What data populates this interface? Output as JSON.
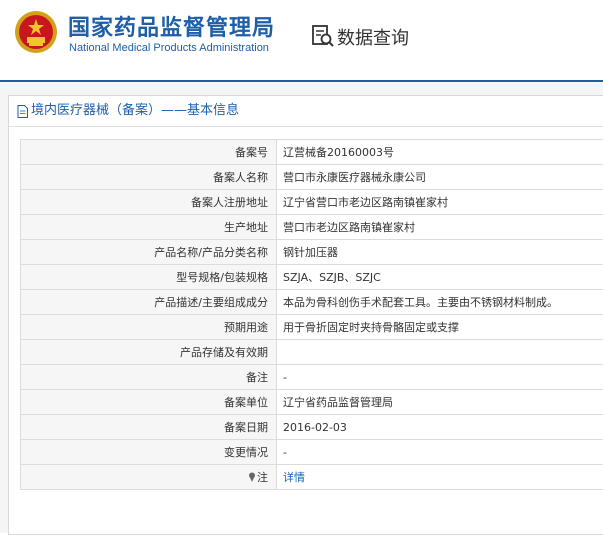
{
  "header": {
    "title": "国家药品监督管理局",
    "subtitle": "National Medical Products Administration",
    "query_label": "数据查询",
    "brand_color": "#1e5fa8"
  },
  "panel": {
    "title": "境内医疗器械（备案）——基本信息"
  },
  "record": {
    "rows": [
      {
        "label": "备案号",
        "value": "辽营械备20160003号"
      },
      {
        "label": "备案人名称",
        "value": "营口市永康医疗器械永康公司"
      },
      {
        "label": "备案人注册地址",
        "value": "辽宁省营口市老边区路南镇崔家村"
      },
      {
        "label": "生产地址",
        "value": "营口市老边区路南镇崔家村"
      },
      {
        "label": "产品名称/产品分类名称",
        "value": "钢针加压器"
      },
      {
        "label": "型号规格/包装规格",
        "value": "SZJA、SZJB、SZJC"
      },
      {
        "label": "产品描述/主要组成成分",
        "value": "本品为骨科创伤手术配套工具。主要由不锈钢材料制成。"
      },
      {
        "label": "预期用途",
        "value": "用于骨折固定时夹持骨骼固定或支撑"
      },
      {
        "label": "产品存储及有效期",
        "value": ""
      },
      {
        "label": "备注",
        "value": "-"
      },
      {
        "label": "备案单位",
        "value": "辽宁省药品监督管理局"
      },
      {
        "label": "备案日期",
        "value": "2016-02-03"
      },
      {
        "label": "变更情况",
        "value": "-"
      }
    ],
    "note": {
      "label": "注",
      "link_text": "详情"
    }
  }
}
